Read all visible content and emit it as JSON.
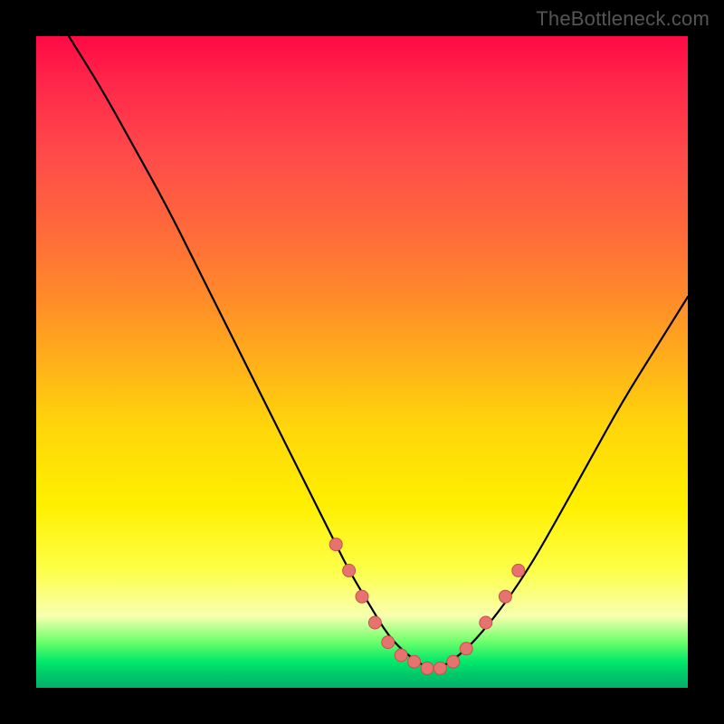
{
  "watermark": "TheBottleneck.com",
  "colors": {
    "dot_fill": "#e6736f",
    "dot_stroke": "#c94f4a",
    "line": "#000000",
    "frame": "#000000"
  },
  "chart_data": {
    "type": "line",
    "title": "",
    "xlabel": "",
    "ylabel": "",
    "xlim": [
      0,
      100
    ],
    "ylim": [
      0,
      100
    ],
    "description": "V-shaped curve descending from top-left to a minimum near x≈58–62 and rising to the right; highlighted beads cluster in the trough and along the lower flanks.",
    "series": [
      {
        "name": "curve",
        "x": [
          5,
          10,
          15,
          20,
          25,
          30,
          35,
          40,
          45,
          48,
          51,
          54,
          57,
          60,
          62,
          65,
          68,
          72,
          76,
          80,
          85,
          90,
          95,
          100
        ],
        "y": [
          100,
          92,
          83,
          74,
          64,
          54,
          44,
          34,
          24,
          18,
          13,
          8,
          5,
          3,
          3,
          5,
          8,
          13,
          19,
          26,
          35,
          44,
          52,
          60
        ]
      }
    ],
    "highlight_points": {
      "x": [
        46,
        48,
        50,
        52,
        54,
        56,
        58,
        60,
        62,
        64,
        66,
        69,
        72,
        74
      ],
      "y": [
        22,
        18,
        14,
        10,
        7,
        5,
        4,
        3,
        3,
        4,
        6,
        10,
        14,
        18
      ]
    }
  }
}
